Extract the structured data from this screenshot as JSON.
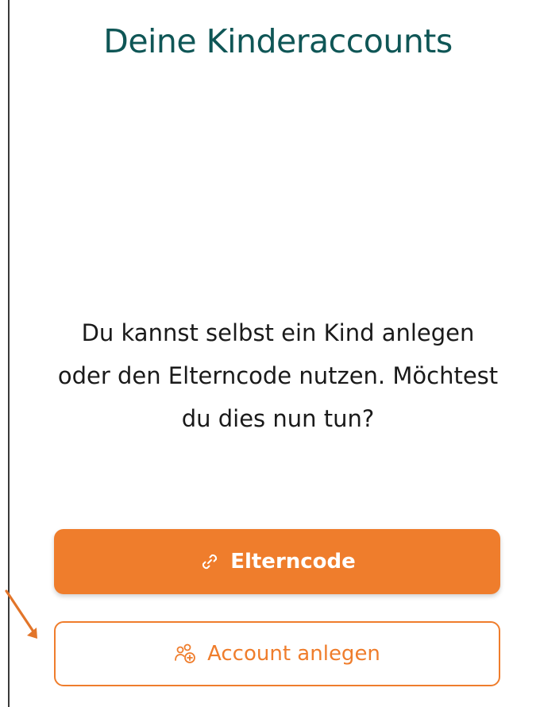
{
  "page": {
    "title": "Deine Kinderaccounts",
    "message": "Du kannst selbst ein Kind anlegen oder den Elterncode nutzen. Möchtest du dies nun tun?"
  },
  "buttons": {
    "elterncode": {
      "label": "Elterncode",
      "icon": "link-icon"
    },
    "account_anlegen": {
      "label": "Account anlegen",
      "icon": "add-users-icon"
    }
  },
  "colors": {
    "title": "#0f5656",
    "accent": "#ef7d2c",
    "annotation_arrow": "#e2752a"
  }
}
